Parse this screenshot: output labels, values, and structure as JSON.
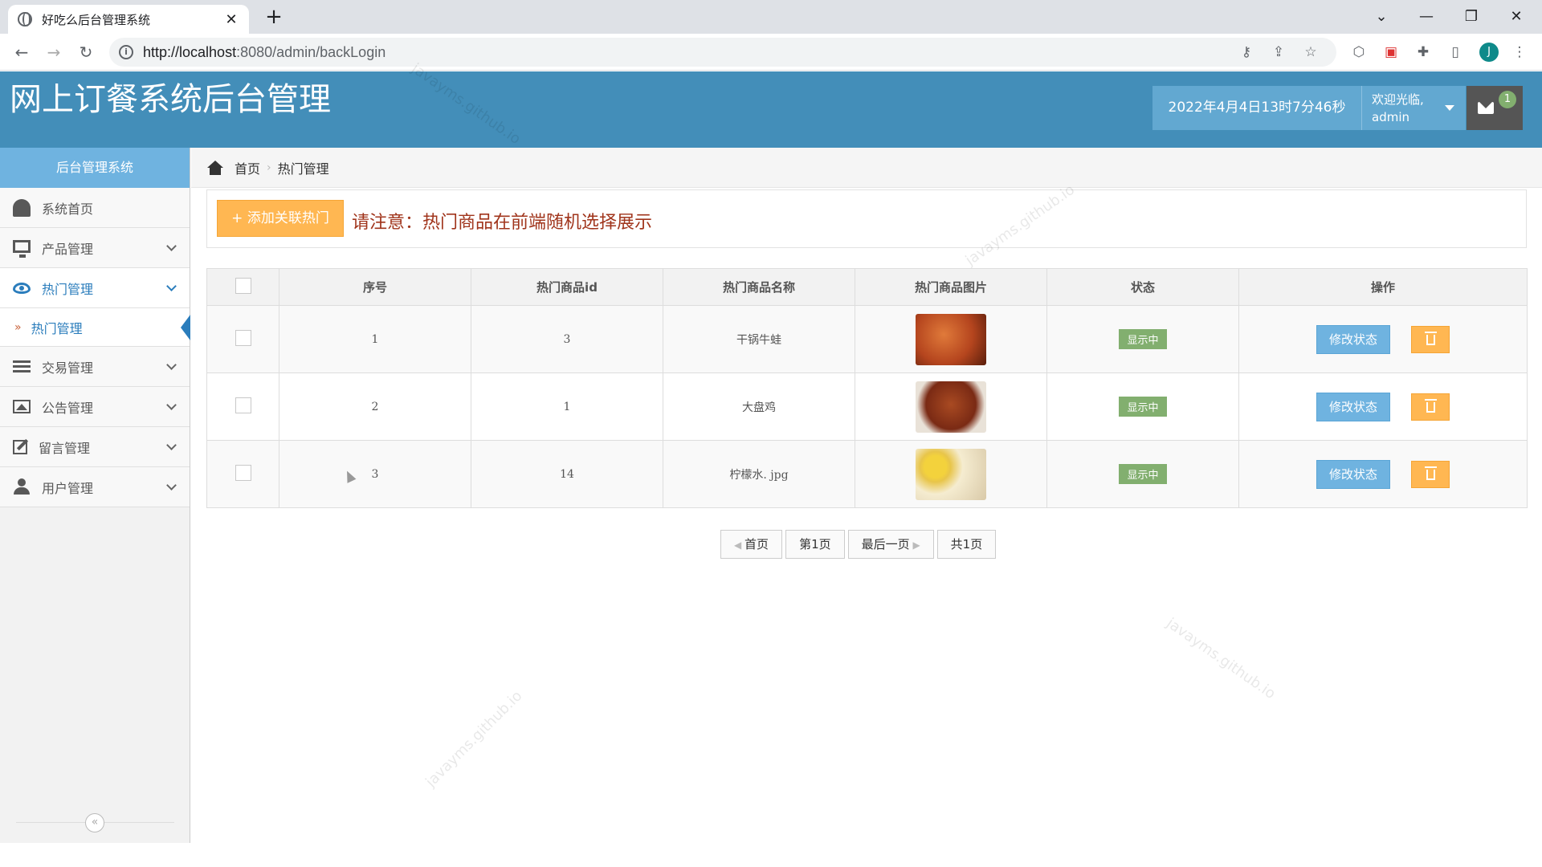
{
  "browser": {
    "tab_title": "好吃么后台管理系统",
    "tab_close": "✕",
    "new_tab": "+",
    "url_host": "http://localhost",
    "url_rest": ":8080/admin/backLogin",
    "avatar_letter": "J"
  },
  "header": {
    "title": "网上订餐系统后台管理",
    "datetime": "2022年4月4日13时7分46秒",
    "welcome": "欢迎光临,",
    "username": "admin",
    "mail_count": "1",
    "watermark": "javayms.github.io"
  },
  "sidebar": {
    "heading": "后台管理系统",
    "items": [
      {
        "label": "系统首页",
        "icon": "dashboard-icon"
      },
      {
        "label": "产品管理",
        "icon": "monitor-icon"
      },
      {
        "label": "热门管理",
        "icon": "eye-icon"
      },
      {
        "label": "交易管理",
        "icon": "list-icon"
      },
      {
        "label": "公告管理",
        "icon": "picture-icon"
      },
      {
        "label": "留言管理",
        "icon": "edit-icon"
      },
      {
        "label": "用户管理",
        "icon": "users-icon"
      }
    ],
    "active_sub": "热门管理",
    "collapse": "«"
  },
  "breadcrumb": {
    "home": "首页",
    "current": "热门管理"
  },
  "toolbar": {
    "add_label": "+ 添加关联热门",
    "notice": "请注意：热门商品在前端随机选择展示"
  },
  "table": {
    "headers": [
      "序号",
      "热门商品id",
      "热门商品名称",
      "热门商品图片",
      "状态",
      "操作"
    ],
    "rows": [
      {
        "no": "1",
        "id": "3",
        "name": "干锅牛蛙",
        "status": "显示中",
        "image_color": "#b5451e"
      },
      {
        "no": "2",
        "id": "1",
        "name": "大盘鸡",
        "status": "显示中",
        "image_color": "#7a2a14"
      },
      {
        "no": "3",
        "id": "14",
        "name": "柠檬水. jpg",
        "status": "显示中",
        "image_color": "#e8c54a"
      }
    ],
    "modify_label": "修改状态"
  },
  "pager": {
    "first": "首页",
    "page": "第1页",
    "last": "最后一页",
    "total": "共1页"
  },
  "colors": {
    "header": "#438eb9",
    "sidebar_head": "#6fb3e0",
    "warning": "#ffb752",
    "success": "#82af6f"
  }
}
